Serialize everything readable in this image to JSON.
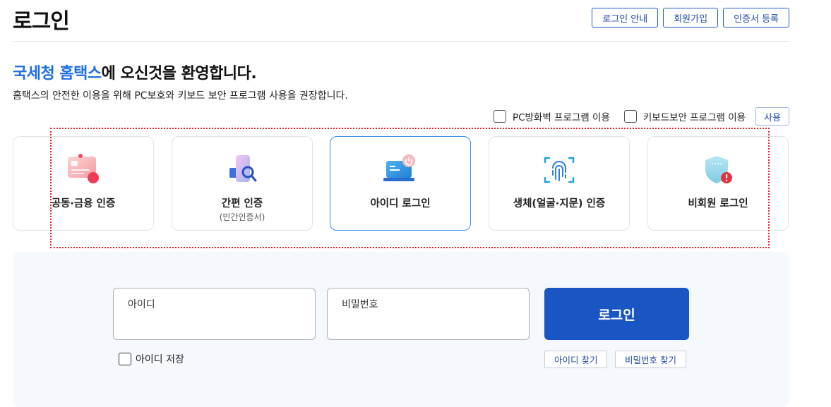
{
  "header": {
    "title": "로그인",
    "links": [
      "로그인 안내",
      "회원가입",
      "인증서 등록"
    ]
  },
  "welcome": {
    "accent": "국세청 홈택스",
    "rest": "에 오신것을 환영합니다.",
    "subtext": "홈택스의 안전한 이용을 위해 PC보호와 키보드 보안 프로그램 사용을 권장합니다."
  },
  "security": {
    "pc_firewall_label": "PC방화벽 프로그램 이용",
    "keyboard_security_label": "키보드보안 프로그램 이용",
    "use_button": "사용"
  },
  "methods": [
    {
      "label": "공동·금융 인증",
      "sublabel": "",
      "icon": "certificate-card-icon"
    },
    {
      "label": "간편 인증",
      "sublabel": "(민간인증서)",
      "icon": "simple-auth-phone-icon"
    },
    {
      "label": "아이디 로그인",
      "sublabel": "",
      "icon": "laptop-power-icon",
      "selected": true
    },
    {
      "label": "생체(얼굴·지문) 인증",
      "sublabel": "",
      "icon": "fingerprint-icon"
    },
    {
      "label": "비회원 로그인",
      "sublabel": "",
      "icon": "shield-alert-icon"
    }
  ],
  "login": {
    "id_placeholder": "아이디",
    "password_placeholder": "비밀번호",
    "submit": "로그인",
    "save_id": "아이디 저장",
    "find_id": "아이디 찾기",
    "find_password": "비밀번호 찾기"
  },
  "colors": {
    "accent": "#1f6fe0",
    "primary_button": "#1a56c3",
    "selected_border": "#3a8fe6",
    "highlight_border": "#e8202a"
  }
}
